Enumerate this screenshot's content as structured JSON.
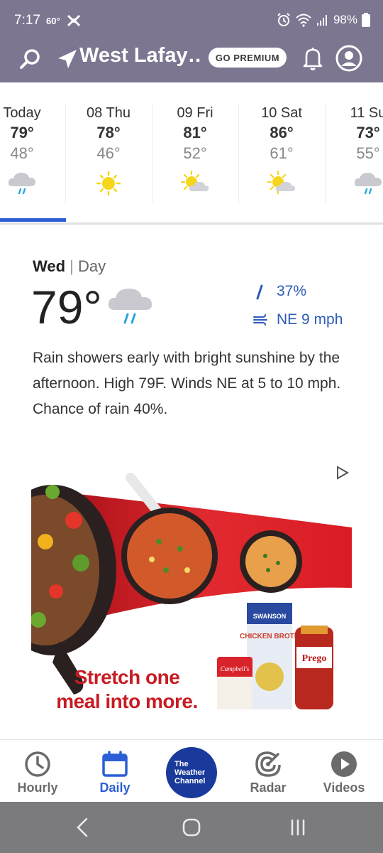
{
  "status_bar": {
    "time": "7:17",
    "temp": "60°",
    "battery": "98%"
  },
  "header": {
    "location": "West Lafay…",
    "premium_label": "GO PREMIUM"
  },
  "days": [
    {
      "name": "Today",
      "high": "79°",
      "low": "48°",
      "icon": "rain-cloud-icon"
    },
    {
      "name": "08 Thu",
      "high": "78°",
      "low": "46°",
      "icon": "sun-icon"
    },
    {
      "name": "09 Fri",
      "high": "81°",
      "low": "52°",
      "icon": "partly-cloudy-icon"
    },
    {
      "name": "10 Sat",
      "high": "86°",
      "low": "61°",
      "icon": "partly-cloudy-icon"
    },
    {
      "name": "11 Su",
      "high": "73°",
      "low": "55°",
      "icon": "rain-cloud-icon"
    }
  ],
  "detail": {
    "day": "Wed",
    "separator": "|",
    "period": "Day",
    "temp": "79°",
    "precip": "37%",
    "wind": "NE 9 mph",
    "description": "Rain showers early with bright sunshine by the afternoon. High 79F. Winds NE at 5 to 10 mph. Chance of rain 40%."
  },
  "ad": {
    "slogan_line1": "Stretch one",
    "slogan_line2": "meal into more.",
    "brand1": "SWANSON",
    "brand2": "CHICKEN BROTH",
    "brand3": "Prego",
    "brand4": "Campbell's"
  },
  "nav": {
    "hourly": "Hourly",
    "daily": "Daily",
    "logo_line1": "The",
    "logo_line2": "Weather",
    "logo_line3": "Channel",
    "radar": "Radar",
    "videos": "Videos"
  },
  "colors": {
    "header_bg": "#7d7691",
    "accent_blue": "#2c5fd6",
    "ad_red": "#c81b23"
  }
}
